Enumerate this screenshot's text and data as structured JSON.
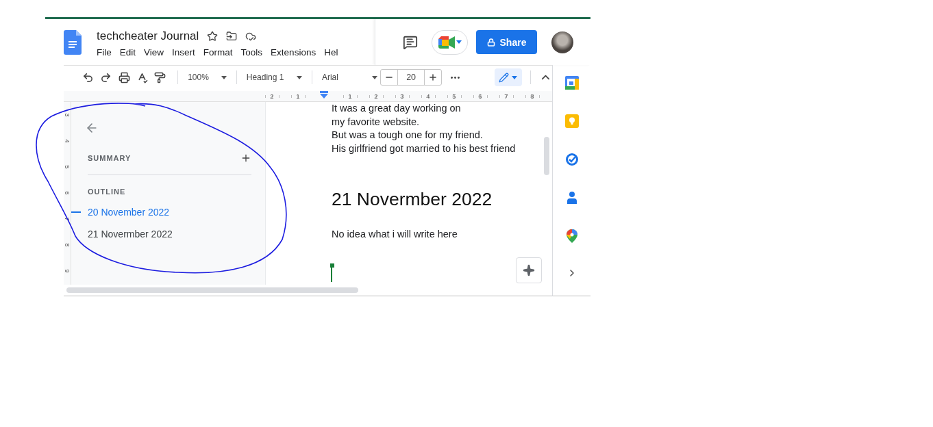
{
  "document": {
    "title": "techcheater Journal"
  },
  "menu": [
    "File",
    "Edit",
    "View",
    "Insert",
    "Format",
    "Tools",
    "Extensions",
    "Hel"
  ],
  "share_button": "Share",
  "toolbar": {
    "zoom": "100%",
    "style": "Heading 1",
    "font": "Arial",
    "font_size": "20"
  },
  "ruler": {
    "horizontal": [
      "2",
      "1",
      "1",
      "2",
      "3",
      "4",
      "5",
      "6",
      "7",
      "8"
    ],
    "vertical": [
      "3",
      "4",
      "5",
      "6",
      "7",
      "8",
      "9"
    ]
  },
  "outline_panel": {
    "summary_label": "SUMMARY",
    "outline_label": "OUTLINE",
    "headings": [
      {
        "text": "20 November 2022",
        "selected": true
      },
      {
        "text": "21 Novermber 2022",
        "selected": false
      }
    ]
  },
  "document_body": [
    {
      "kind": "paragraph",
      "text": "It was a great day working on"
    },
    {
      "kind": "paragraph",
      "text": "my favorite website."
    },
    {
      "kind": "paragraph",
      "text": "But was a tough one for my friend."
    },
    {
      "kind": "paragraph",
      "text": "His girlfriend got married to his best friend"
    },
    {
      "kind": "heading",
      "text": "21 Novermber 2022"
    },
    {
      "kind": "paragraph",
      "text": "No idea what i will write here"
    }
  ]
}
